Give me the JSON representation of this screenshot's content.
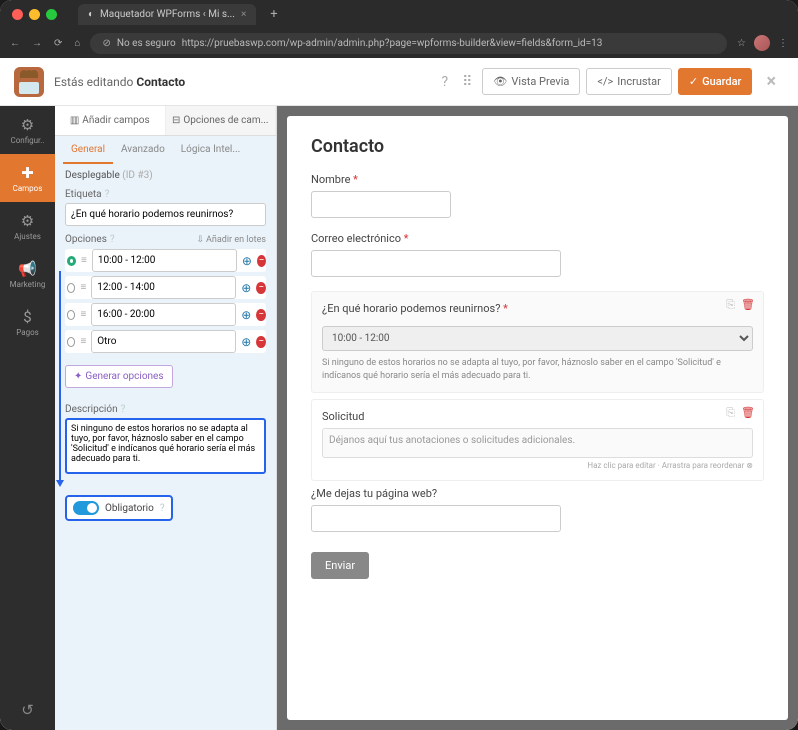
{
  "browser": {
    "tab_title": "Maquetador WPForms ‹ Mi s...",
    "security": "No es seguro",
    "url": "https://pruebaswp.com/wp-admin/admin.php?page=wpforms-builder&view=fields&form_id=13"
  },
  "header": {
    "editing_prefix": "Estás editando ",
    "editing_name": "Contacto",
    "preview": "Vista Previa",
    "embed": "Incrustar",
    "save": "Guardar"
  },
  "sidebar": {
    "items": [
      {
        "label": "Configur..",
        "icon": "⚙"
      },
      {
        "label": "Campos",
        "icon": "✚"
      },
      {
        "label": "Ajustes",
        "icon": "⚙"
      },
      {
        "label": "Marketing",
        "icon": "📢"
      },
      {
        "label": "Pagos",
        "icon": "$"
      }
    ]
  },
  "panel": {
    "tabs": {
      "add": "Añadir campos",
      "options": "Opciones de cam..."
    },
    "subtabs": {
      "general": "General",
      "advanced": "Avanzado",
      "logic": "Lógica Intel..."
    },
    "field_title": "Desplegable",
    "field_id": "(ID #3)",
    "label_label": "Etiqueta",
    "label_value": "¿En qué horario podemos reunirnos?",
    "options_label": "Opciones",
    "bulk": "Añadir en lotes",
    "options": [
      "10:00 - 12:00",
      "12:00 - 14:00",
      "16:00 - 20:00",
      "Otro"
    ],
    "generate": "Generar opciones",
    "desc_label": "Descripción",
    "desc_value": "Si ninguno de estos horarios no se adapta al tuyo, por favor, háznoslo saber en el campo 'Solicitud' e indícanos qué horario sería el más adecuado para ti.",
    "required": "Obligatorio"
  },
  "preview": {
    "title": "Contacto",
    "name_label": "Nombre",
    "email_label": "Correo electrónico",
    "schedule_label": "¿En qué horario podemos reunirnos?",
    "schedule_value": "10:00 - 12:00",
    "schedule_desc": "Si ninguno de estos horarios no se adapta al tuyo, por favor, háznoslo saber en el campo 'Solicitud' e indícanos qué horario sería el más adecuado para ti.",
    "request_label": "Solicitud",
    "request_placeholder": "Déjanos aquí tus anotaciones o solicitudes adicionales.",
    "edit_hint": "Haz clic para editar · Arrastra para reordenar",
    "web_label": "¿Me dejas tu página web?",
    "submit": "Enviar"
  }
}
